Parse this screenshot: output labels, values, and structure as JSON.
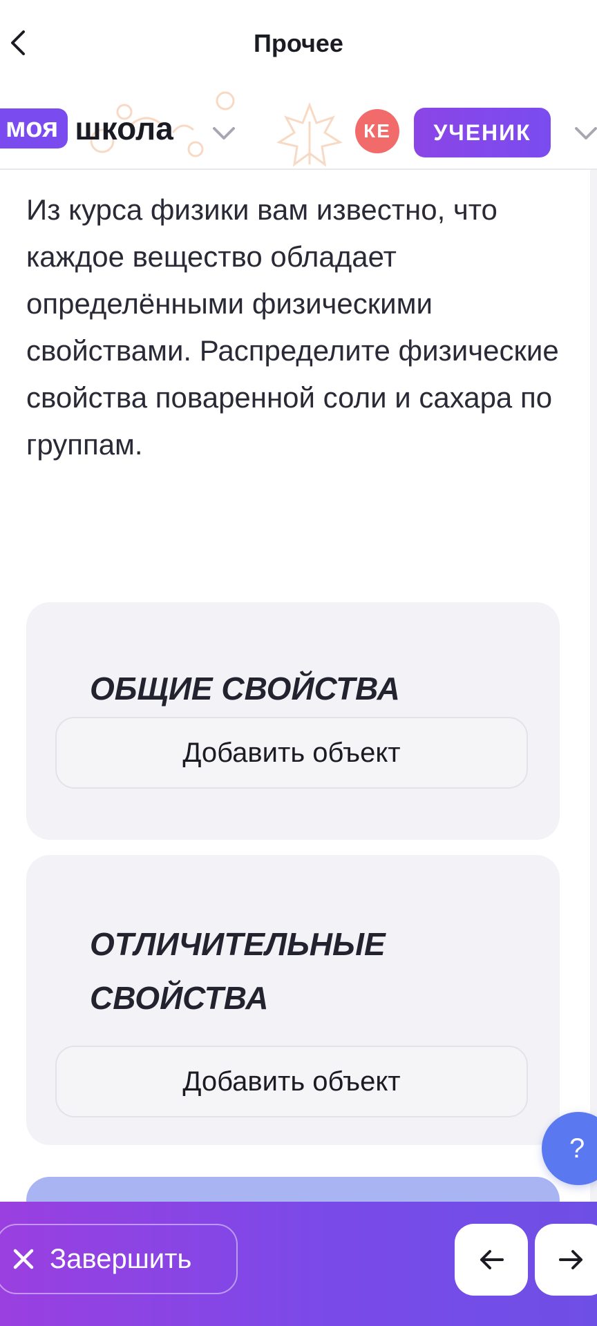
{
  "header": {
    "title": "Прочее"
  },
  "brand": {
    "logo_pill": "моя",
    "logo_word": "школа",
    "avatar_initials": "КЕ",
    "role_label": "УЧЕНИК"
  },
  "task": {
    "question": "Из курса физики вам известно, что каждое вещество обладает определёнными физическими свойствами. Распределите физические свойства поваренной соли и сахара по группам.",
    "groups": [
      {
        "title": "Общие свойства",
        "add_label": "Добавить объект"
      },
      {
        "title": "Отличительные свойства",
        "add_label": "Добавить объект"
      }
    ]
  },
  "help": {
    "label": "?"
  },
  "footer": {
    "finish_label": "Завершить"
  },
  "colors": {
    "accent": "#7a4cf0",
    "avatar": "#f26b6b",
    "help": "#5a78f0",
    "card_bg": "#f3f3f7"
  },
  "icons": {
    "back": "chevron-left-icon",
    "brand_dropdown": "chevron-down-icon",
    "role_dropdown": "chevron-down-icon",
    "finish": "close-icon",
    "prev": "arrow-left-icon",
    "next": "arrow-right-icon"
  }
}
